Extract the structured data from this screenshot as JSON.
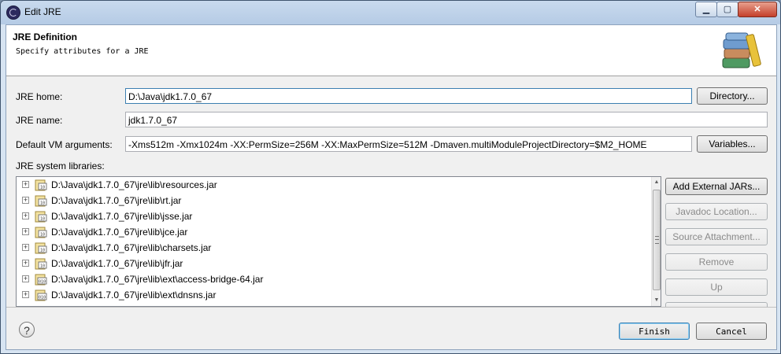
{
  "window": {
    "title": "Edit JRE",
    "controls": {
      "minimize": "▁",
      "maximize": "▢",
      "close": "✕"
    }
  },
  "header": {
    "title": "JRE Definition",
    "subtitle": "Specify attributes for a JRE",
    "icon": "library-books-icon"
  },
  "form": {
    "jre_home": {
      "label": "JRE home:",
      "value": "D:\\Java\\jdk1.7.0_67",
      "button": "Directory..."
    },
    "jre_name": {
      "label": "JRE name:",
      "value": "jdk1.7.0_67"
    },
    "vm_args": {
      "label": "Default VM arguments:",
      "value": "-Xms512m -Xmx1024m -XX:PermSize=256M -XX:MaxPermSize=512M -Dmaven.multiModuleProjectDirectory=$M2_HOME",
      "button": "Variables..."
    }
  },
  "libraries": {
    "label": "JRE system libraries:",
    "items": [
      {
        "path": "D:\\Java\\jdk1.7.0_67\\jre\\lib\\resources.jar",
        "icon": "jar-icon",
        "badge": "10"
      },
      {
        "path": "D:\\Java\\jdk1.7.0_67\\jre\\lib\\rt.jar",
        "icon": "jar-icon",
        "badge": "10"
      },
      {
        "path": "D:\\Java\\jdk1.7.0_67\\jre\\lib\\jsse.jar",
        "icon": "jar-icon",
        "badge": "10"
      },
      {
        "path": "D:\\Java\\jdk1.7.0_67\\jre\\lib\\jce.jar",
        "icon": "jar-icon",
        "badge": "10"
      },
      {
        "path": "D:\\Java\\jdk1.7.0_67\\jre\\lib\\charsets.jar",
        "icon": "jar-icon",
        "badge": "10"
      },
      {
        "path": "D:\\Java\\jdk1.7.0_67\\jre\\lib\\jfr.jar",
        "icon": "jar-icon",
        "badge": "10"
      },
      {
        "path": "D:\\Java\\jdk1.7.0_67\\jre\\lib\\ext\\access-bridge-64.jar",
        "icon": "jar-icon",
        "badge": "010"
      },
      {
        "path": "D:\\Java\\jdk1.7.0_67\\jre\\lib\\ext\\dnsns.jar",
        "icon": "jar-icon",
        "badge": "010"
      }
    ],
    "buttons": {
      "add_external": "Add External JARs...",
      "javadoc": "Javadoc Location...",
      "source": "Source Attachment...",
      "remove": "Remove",
      "up": "Up"
    }
  },
  "footer": {
    "help": "?",
    "finish": "Finish",
    "cancel": "Cancel"
  },
  "colors": {
    "title_bar": "#c9daee",
    "dialog_bg": "#f0f0f0",
    "focus_border": "#3c7fb1"
  }
}
